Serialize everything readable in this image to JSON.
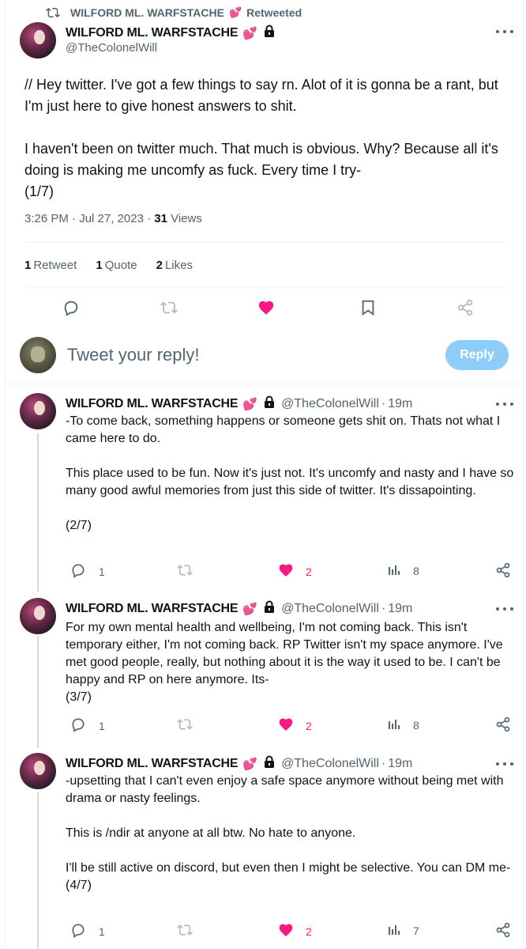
{
  "retweet_bar": {
    "label": "WILFORD ML. WARFSTACHE",
    "suffix": "Retweeted"
  },
  "main_tweet": {
    "display_name": "WILFORD ML. WARFSTACHE",
    "handle": "@TheColonelWill",
    "paragraphs": [
      "// Hey twitter. I've got a few things to say rn. Alot of it is gonna be a rant, but I'm just here to give honest answers to shit.",
      "I haven't been on twitter much. That much is obvious. Why? Because all it's doing is making me uncomfy as fuck. Every time I try-",
      "(1/7)"
    ],
    "timestamp": "3:26 PM · Jul 27, 2023 · ",
    "views_count": "31",
    "views_label": " Views",
    "stats": {
      "retweets_count": "1",
      "retweets_label": "Retweet",
      "quotes_count": "1",
      "quotes_label": "Quote",
      "likes_count": "2",
      "likes_label": "Likes"
    }
  },
  "reply_compose": {
    "placeholder": "Tweet your reply!",
    "button_label": "Reply"
  },
  "replies": [
    {
      "display_name": "WILFORD ML. WARFSTACHE",
      "handle": "@TheColonelWill",
      "time": "19m",
      "lines": [
        "-To come back, something happens or someone gets shit on. Thats not what I came here to do.",
        "This place used to be fun. Now it's just not. It's uncomfy and nasty and I have so many good awful memories from just this side of twitter. It's dissapointing.",
        "(2/7)"
      ],
      "replies": "1",
      "likes": "2",
      "views": "8"
    },
    {
      "display_name": "WILFORD ML. WARFSTACHE",
      "handle": "@TheColonelWill",
      "time": "19m",
      "lines": [
        "For my own mental health and wellbeing, I'm not coming back. This isn't temporary either, I'm not coming back. RP Twitter isn't my space anymore. I've met good people, really, but nothing about it is the way it used to be. I can't be happy and RP on here anymore. Its-",
        "(3/7)"
      ],
      "replies": "1",
      "likes": "2",
      "views": "8"
    },
    {
      "display_name": "WILFORD ML. WARFSTACHE",
      "handle": "@TheColonelWill",
      "time": "19m",
      "lines": [
        "-upsetting that I can't even enjoy a safe space anymore without being met with drama or nasty feelings.",
        "This is /ndir at anyone at all btw. No hate to anyone.",
        "I'll be still active on discord, but even then I might be selective. You can DM me-",
        "(4/7)"
      ],
      "replies": "1",
      "likes": "2",
      "views": "7"
    }
  ],
  "separator": "·",
  "colors": {
    "like": "#f91880",
    "muted": "#536471",
    "reply_button": "#8ecdf8",
    "divider": "#eff3f4"
  },
  "icons": [
    "retweet-icon",
    "pink-hearts-icon",
    "lock-icon",
    "more-icon",
    "reply-icon",
    "heart-filled-icon",
    "bookmark-icon",
    "share-icon",
    "views-icon"
  ]
}
